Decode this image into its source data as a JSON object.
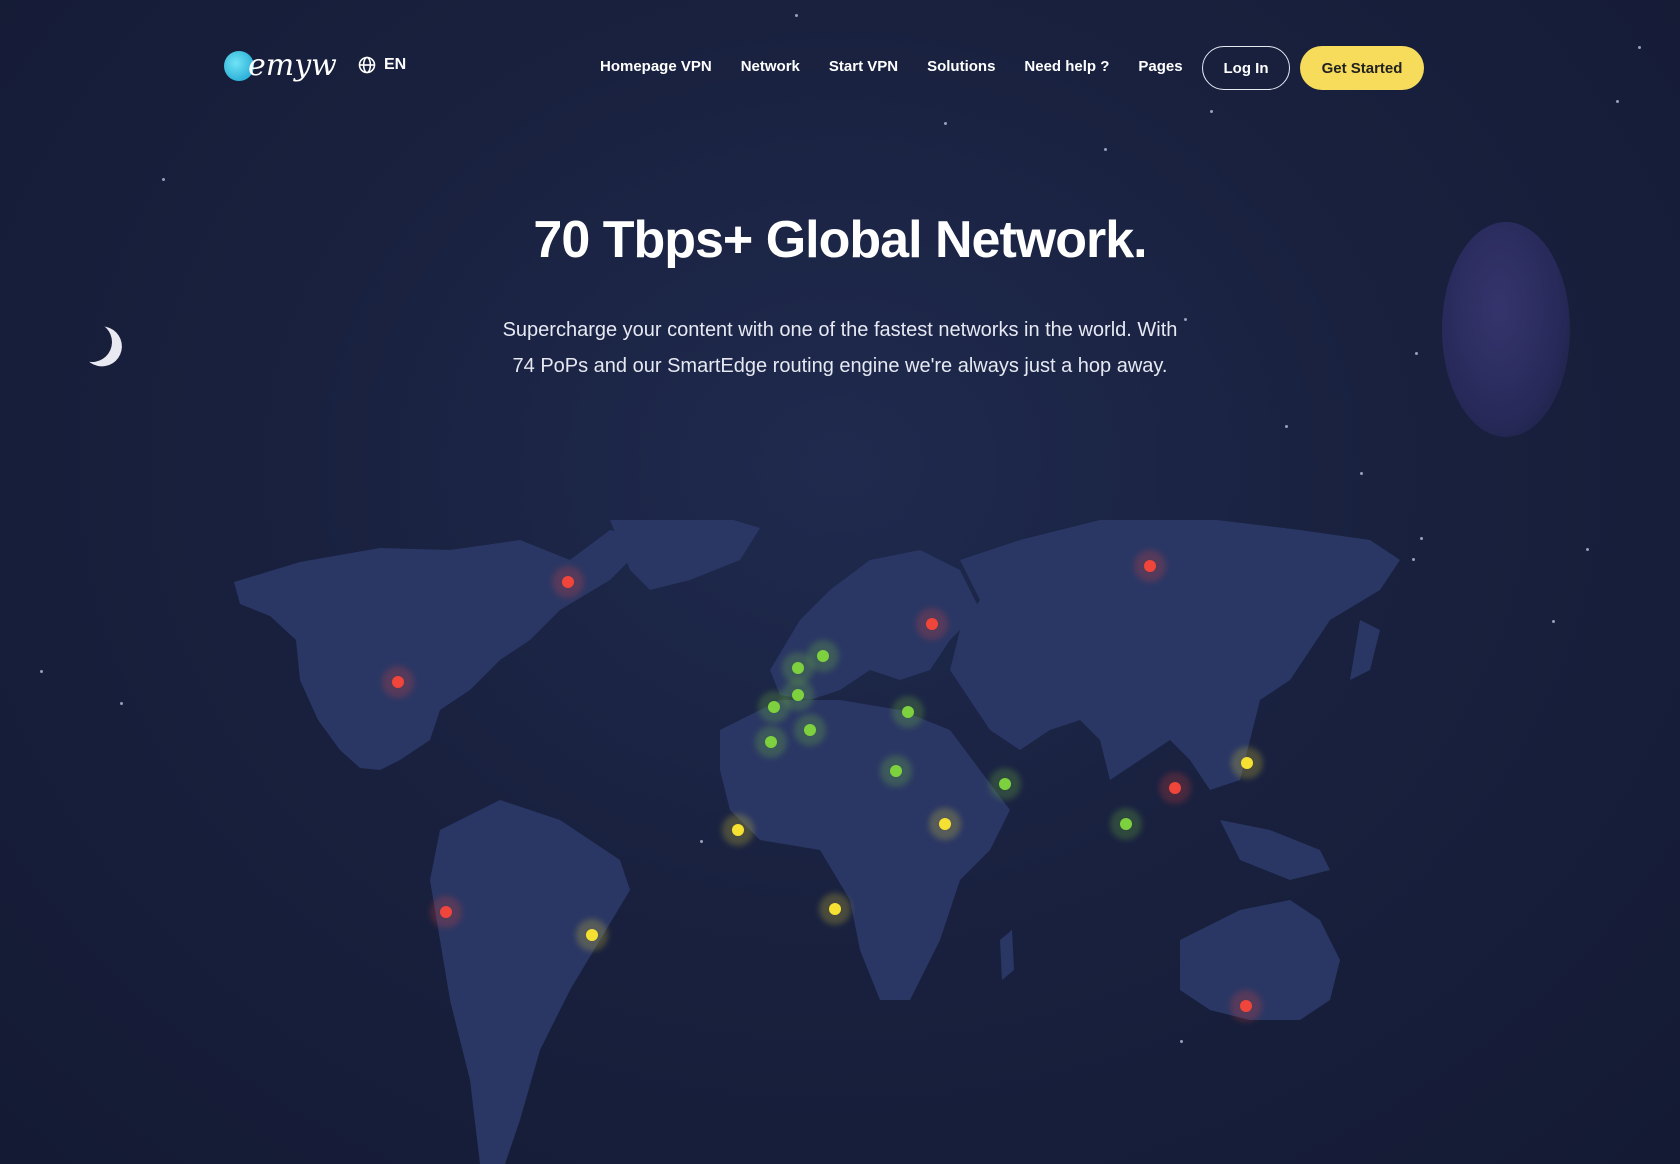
{
  "brand": {
    "name": "emyw"
  },
  "language": {
    "code": "EN",
    "icon": "globe-icon"
  },
  "nav": {
    "items": [
      {
        "label": "Homepage VPN"
      },
      {
        "label": "Network"
      },
      {
        "label": "Start VPN"
      },
      {
        "label": "Solutions"
      },
      {
        "label": "Need help ?"
      },
      {
        "label": "Pages"
      }
    ]
  },
  "auth": {
    "login_label": "Log In",
    "cta_label": "Get Started"
  },
  "hero": {
    "title": "70 Tbps+ Global Network.",
    "subtitle": "Supercharge your content with one of the fastest networks in the world. With 74 PoPs and our SmartEdge routing engine we're always just a hop away."
  },
  "colors": {
    "background": "#19213f",
    "continent": "#2a3764",
    "cta": "#f6dc5a",
    "pop_red": "#f0453a",
    "pop_green": "#7ed13e",
    "pop_yellow": "#f6e133"
  },
  "map": {
    "pops": [
      {
        "status": "red"
      },
      {
        "status": "red"
      },
      {
        "status": "red"
      },
      {
        "status": "red"
      },
      {
        "status": "red"
      },
      {
        "status": "red"
      },
      {
        "status": "red"
      },
      {
        "status": "green"
      },
      {
        "status": "green"
      },
      {
        "status": "green"
      },
      {
        "status": "green"
      },
      {
        "status": "green"
      },
      {
        "status": "green"
      },
      {
        "status": "green"
      },
      {
        "status": "green"
      },
      {
        "status": "green"
      },
      {
        "status": "green"
      },
      {
        "status": "yellow"
      },
      {
        "status": "yellow"
      },
      {
        "status": "yellow"
      },
      {
        "status": "yellow"
      },
      {
        "status": "yellow"
      }
    ]
  }
}
